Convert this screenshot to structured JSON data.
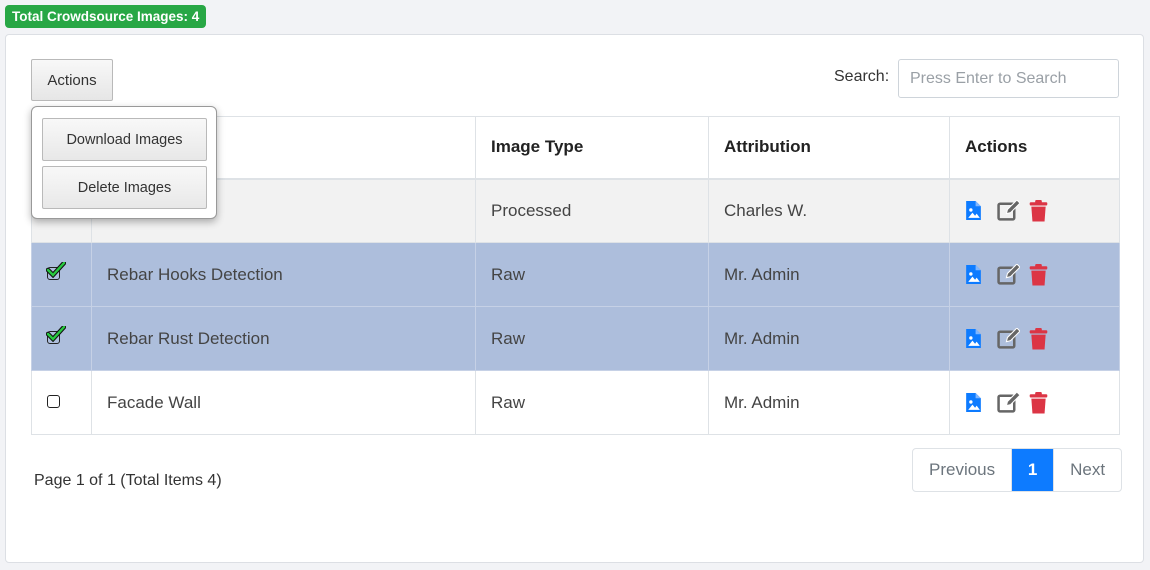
{
  "badge": {
    "label": "Total Crowdsource Images: 4"
  },
  "toolbar": {
    "actions_label": "Actions",
    "search_label": "Search:",
    "search_placeholder": "Press Enter to Search",
    "search_value": ""
  },
  "dropdown": {
    "items": [
      "Download Images",
      "Delete Images"
    ]
  },
  "table": {
    "headers": [
      "",
      "",
      "Image Type",
      "Attribution",
      "Actions"
    ],
    "rows": [
      {
        "checked": false,
        "title": "",
        "image_type": "Processed",
        "attribution": "Charles W.",
        "state": "hovered"
      },
      {
        "checked": true,
        "title": "Rebar Hooks Detection",
        "image_type": "Raw",
        "attribution": "Mr. Admin",
        "state": "selected"
      },
      {
        "checked": true,
        "title": "Rebar Rust Detection",
        "image_type": "Raw",
        "attribution": "Mr. Admin",
        "state": "selected"
      },
      {
        "checked": false,
        "title": "Facade Wall",
        "image_type": "Raw",
        "attribution": "Mr. Admin",
        "state": "normal"
      }
    ],
    "row_icons": [
      "image-file-icon",
      "edit-icon",
      "trash-icon"
    ]
  },
  "pagination": {
    "info": "Page 1 of 1 (Total Items 4)",
    "previous": "Previous",
    "current": "1",
    "next": "Next"
  },
  "colors": {
    "badge_green": "#28a745",
    "selected_row": "#adbedc",
    "accent_blue": "#0d7bff",
    "trash_red": "#dc3545",
    "edit_gray": "#666666"
  }
}
